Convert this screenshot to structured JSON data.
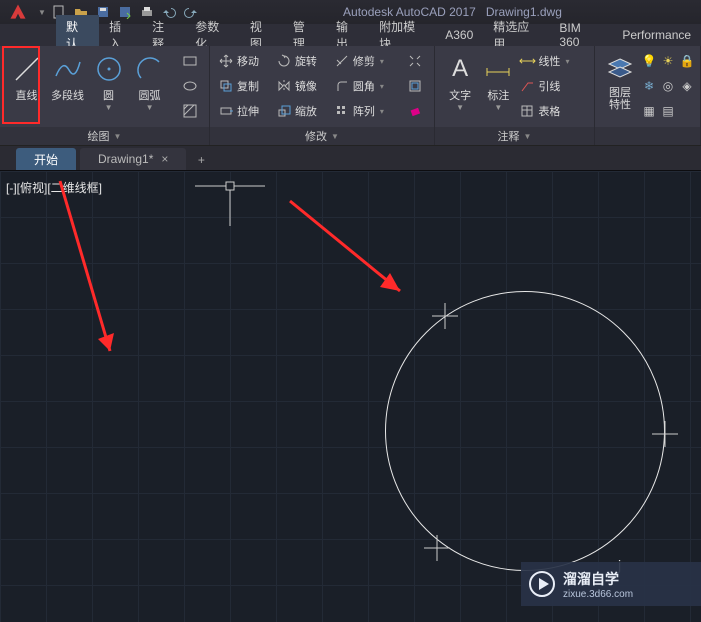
{
  "app": {
    "name": "Autodesk AutoCAD 2017",
    "file": "Drawing1.dwg"
  },
  "menubar": {
    "tabs": [
      "默认",
      "插入",
      "注释",
      "参数化",
      "视图",
      "管理",
      "输出",
      "附加模块",
      "A360",
      "精选应用",
      "BIM 360",
      "Performance"
    ],
    "active": 0
  },
  "ribbon": {
    "draw": {
      "title": "绘图",
      "line": "直线",
      "pline": "多段线",
      "circle": "圆",
      "arc": "圆弧"
    },
    "modify": {
      "title": "修改",
      "move": "移动",
      "rotate": "旋转",
      "trim": "修剪",
      "copy": "复制",
      "mirror": "镜像",
      "fillet": "圆角",
      "stretch": "拉伸",
      "scale": "缩放",
      "array": "阵列"
    },
    "annotate": {
      "title": "注释",
      "text": "文字",
      "dim": "标注",
      "linear": "线性",
      "leader": "引线",
      "table": "表格"
    },
    "layers": {
      "title": "图层\n特性"
    }
  },
  "doc_tabs": {
    "start": "开始",
    "drawing": "Drawing1*"
  },
  "viewport": {
    "label": "[-][俯视][二维线框]"
  },
  "watermark": {
    "brand": "溜溜自学",
    "url": "zixue.3d66.com"
  },
  "cursor_hint": "j"
}
